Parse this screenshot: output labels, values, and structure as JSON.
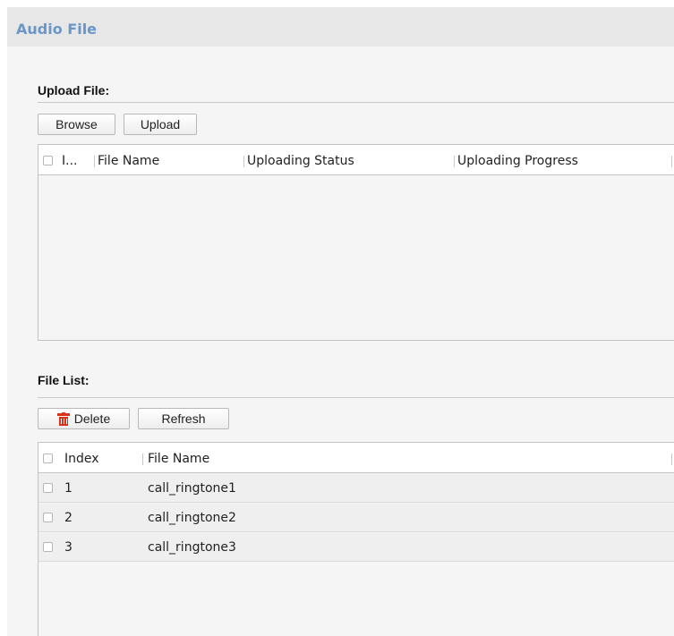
{
  "panel": {
    "title": "Audio File"
  },
  "upload": {
    "title": "Upload File:",
    "browse_label": "Browse",
    "upload_label": "Upload",
    "columns": [
      "I...",
      "File Name",
      "Uploading Status",
      "Uploading Progress"
    ]
  },
  "file_list": {
    "title": "File List:",
    "delete_label": "Delete",
    "refresh_label": "Refresh",
    "columns": [
      "Index",
      "File Name"
    ],
    "rows": [
      {
        "index": "1",
        "file_name": "call_ringtone1"
      },
      {
        "index": "2",
        "file_name": "call_ringtone2"
      },
      {
        "index": "3",
        "file_name": "call_ringtone3"
      }
    ]
  },
  "colors": {
    "title": "#6b96c8",
    "delete_icon": "#d9331b"
  },
  "icons": {
    "delete": "trash-icon"
  }
}
